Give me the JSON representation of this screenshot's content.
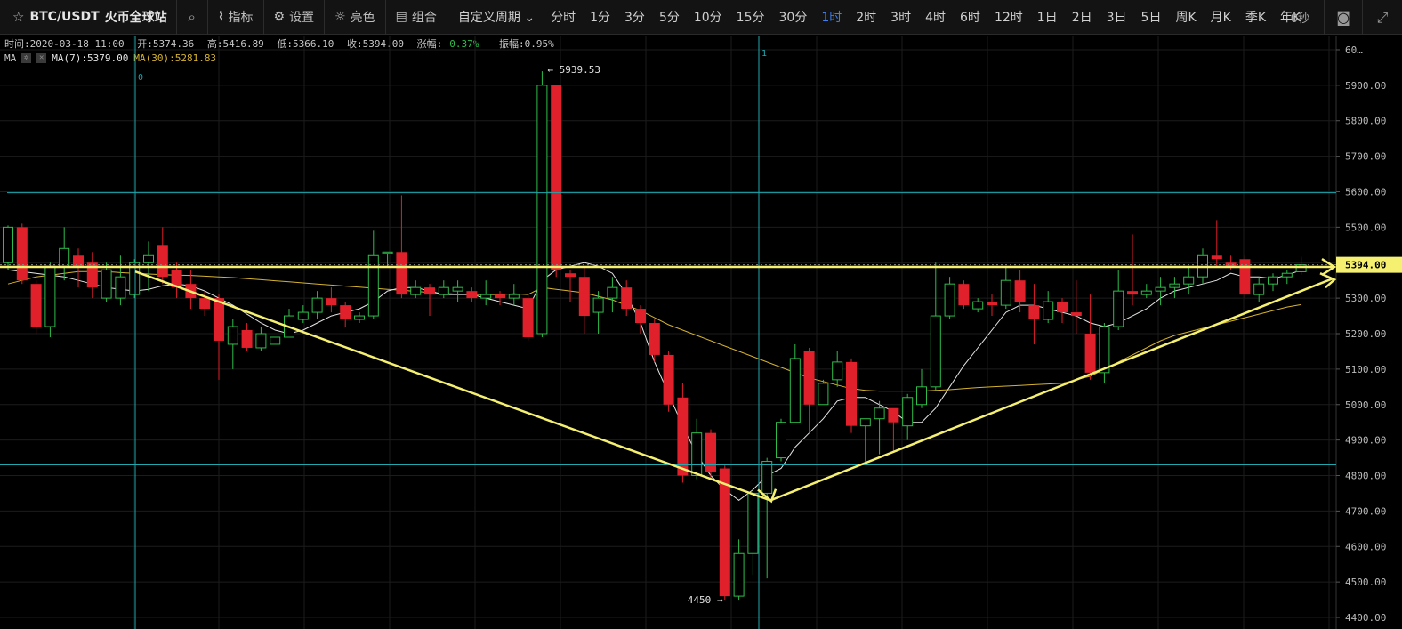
{
  "toolbar": {
    "symbol": "BTC/USDT",
    "exchange": "火币全球站",
    "tools": [
      {
        "icon": "chart-indicator-icon",
        "glyph": "⌇",
        "label": "指标"
      },
      {
        "icon": "gear-icon",
        "glyph": "⚙",
        "label": "设置"
      },
      {
        "icon": "sun-icon",
        "glyph": "☼",
        "label": "亮色"
      },
      {
        "icon": "layout-icon",
        "glyph": "▤",
        "label": "组合"
      }
    ],
    "custom_period": "自定义周期",
    "periods": [
      "分时",
      "1分",
      "3分",
      "5分",
      "10分",
      "15分",
      "30分",
      "1时",
      "2时",
      "3时",
      "4时",
      "6时",
      "12时",
      "1日",
      "2日",
      "3日",
      "5日",
      "周K",
      "月K",
      "季K",
      "年K"
    ],
    "active_period": "1时",
    "countdown": "0秒"
  },
  "info": {
    "time": "时间:2020-03-18 11:00",
    "open": "开:5374.36",
    "high": "高:5416.89",
    "low": "低:5366.10",
    "close": "收:5394.00",
    "change_label": "涨幅:",
    "change_value": "0.37%",
    "amplitude": "振幅:0.95%"
  },
  "ma": {
    "label": "MA",
    "ma7": "MA(7):5379.00",
    "ma30": "MA(30):5281.83"
  },
  "colors": {
    "up": "#2fbd4a",
    "down": "#e0202a",
    "ma7": "#e6e6e6",
    "ma30": "#d4b22e",
    "trendline": "#f5f070",
    "crosshair": "#1fa8b0",
    "grid": "#1c1c1c",
    "active": "#3d7ff5"
  },
  "chart_data": {
    "type": "candlestick",
    "pair": "BTC/USDT",
    "interval": "1h",
    "ylim": [
      4380,
      6020
    ],
    "y_ticks": [
      4400,
      4500,
      4600,
      4700,
      4800,
      4900,
      5000,
      5100,
      5200,
      5300,
      5400,
      5500,
      5600,
      5700,
      5800,
      5900,
      6000
    ],
    "y_tick_labels": [
      "4400.00",
      "4500.00",
      "4600.00",
      "4700.00",
      "4800.00",
      "4900.00",
      "5000.00",
      "5100.00",
      "5200.00",
      "5300.00",
      "",
      "5500.00",
      "5600.00",
      "5700.00",
      "5800.00",
      "5900.00",
      "60…"
    ],
    "last_price": "5394.00",
    "last_price_value": 5394,
    "max_marker": {
      "index": 38,
      "label": "5939.53",
      "value": 5939.53
    },
    "min_marker": {
      "index": 51,
      "label": "4450",
      "value": 4450
    },
    "candles": [
      [
        5400,
        5500,
        5380,
        5505
      ],
      [
        5500,
        5350,
        5340,
        5510
      ],
      [
        5340,
        5220,
        5200,
        5350
      ],
      [
        5220,
        5390,
        5190,
        5400
      ],
      [
        5390,
        5440,
        5350,
        5500
      ],
      [
        5420,
        5390,
        5330,
        5440
      ],
      [
        5400,
        5330,
        5300,
        5430
      ],
      [
        5300,
        5380,
        5290,
        5400
      ],
      [
        5300,
        5360,
        5280,
        5420
      ],
      [
        5310,
        5400,
        5300,
        5410
      ],
      [
        5400,
        5420,
        5320,
        5460
      ],
      [
        5450,
        5360,
        5340,
        5500
      ],
      [
        5380,
        5330,
        5300,
        5400
      ],
      [
        5340,
        5300,
        5270,
        5380
      ],
      [
        5300,
        5270,
        5250,
        5320
      ],
      [
        5300,
        5180,
        5070,
        5310
      ],
      [
        5170,
        5220,
        5100,
        5240
      ],
      [
        5210,
        5160,
        5150,
        5230
      ],
      [
        5160,
        5200,
        5150,
        5220
      ],
      [
        5170,
        5190,
        5170,
        5190
      ],
      [
        5190,
        5250,
        5190,
        5270
      ],
      [
        5240,
        5260,
        5230,
        5280
      ],
      [
        5260,
        5300,
        5240,
        5320
      ],
      [
        5300,
        5280,
        5260,
        5330
      ],
      [
        5280,
        5240,
        5220,
        5290
      ],
      [
        5240,
        5250,
        5230,
        5260
      ],
      [
        5250,
        5420,
        5240,
        5490
      ],
      [
        5430,
        5430,
        5390,
        5430
      ],
      [
        5430,
        5310,
        5300,
        5590
      ],
      [
        5310,
        5330,
        5300,
        5350
      ],
      [
        5330,
        5310,
        5250,
        5340
      ],
      [
        5310,
        5330,
        5300,
        5350
      ],
      [
        5320,
        5330,
        5290,
        5350
      ],
      [
        5320,
        5300,
        5290,
        5330
      ],
      [
        5300,
        5310,
        5280,
        5350
      ],
      [
        5310,
        5300,
        5280,
        5320
      ],
      [
        5300,
        5310,
        5280,
        5340
      ],
      [
        5300,
        5190,
        5180,
        5310
      ],
      [
        5200,
        5900,
        5190,
        5939.53
      ],
      [
        5900,
        5380,
        5360,
        5900
      ],
      [
        5370,
        5360,
        5290,
        5380
      ],
      [
        5360,
        5250,
        5200,
        5390
      ],
      [
        5260,
        5300,
        5200,
        5320
      ],
      [
        5300,
        5330,
        5260,
        5360
      ],
      [
        5330,
        5270,
        5250,
        5350
      ],
      [
        5270,
        5230,
        5200,
        5280
      ],
      [
        5230,
        5140,
        5120,
        5240
      ],
      [
        5140,
        5000,
        4980,
        5150
      ],
      [
        5020,
        4800,
        4780,
        5060
      ],
      [
        4800,
        4920,
        4790,
        4960
      ],
      [
        4920,
        4810,
        4790,
        4930
      ],
      [
        4820,
        4460,
        4450,
        4830
      ],
      [
        4460,
        4580,
        4450,
        4620
      ],
      [
        4580,
        4750,
        4520,
        4760
      ],
      [
        4750,
        4840,
        4510,
        4850
      ],
      [
        4850,
        4950,
        4840,
        4960
      ],
      [
        4950,
        5130,
        4950,
        5170
      ],
      [
        5150,
        5000,
        4920,
        5160
      ],
      [
        5000,
        5060,
        5000,
        5070
      ],
      [
        5070,
        5120,
        5050,
        5150
      ],
      [
        5120,
        4940,
        4920,
        5130
      ],
      [
        4940,
        4960,
        4830,
        4960
      ],
      [
        4960,
        4990,
        4860,
        5010
      ],
      [
        4990,
        4950,
        4870,
        4980
      ],
      [
        4940,
        5020,
        4900,
        5030
      ],
      [
        5000,
        5050,
        4990,
        5100
      ],
      [
        5050,
        5250,
        5040,
        5400
      ],
      [
        5250,
        5340,
        5240,
        5360
      ],
      [
        5340,
        5280,
        5270,
        5350
      ],
      [
        5270,
        5290,
        5260,
        5300
      ],
      [
        5290,
        5280,
        5250,
        5310
      ],
      [
        5280,
        5350,
        5270,
        5390
      ],
      [
        5350,
        5290,
        5260,
        5380
      ],
      [
        5280,
        5240,
        5170,
        5340
      ],
      [
        5240,
        5290,
        5230,
        5320
      ],
      [
        5290,
        5260,
        5230,
        5300
      ],
      [
        5260,
        5250,
        5200,
        5350
      ],
      [
        5200,
        5090,
        5070,
        5310
      ],
      [
        5090,
        5220,
        5060,
        5230
      ],
      [
        5220,
        5320,
        5210,
        5380
      ],
      [
        5320,
        5310,
        5280,
        5480
      ],
      [
        5310,
        5320,
        5300,
        5340
      ],
      [
        5320,
        5330,
        5280,
        5360
      ],
      [
        5330,
        5340,
        5300,
        5360
      ],
      [
        5340,
        5360,
        5310,
        5390
      ],
      [
        5360,
        5420,
        5340,
        5440
      ],
      [
        5420,
        5410,
        5390,
        5520
      ],
      [
        5400,
        5390,
        5380,
        5420
      ],
      [
        5410,
        5310,
        5300,
        5420
      ],
      [
        5310,
        5340,
        5290,
        5360
      ],
      [
        5340,
        5360,
        5320,
        5370
      ],
      [
        5360,
        5370,
        5340,
        5380
      ],
      [
        5374.36,
        5394.0,
        5366.1,
        5416.89
      ]
    ],
    "ma7": [
      5380,
      5375,
      5370,
      5365,
      5360,
      5350,
      5340,
      5330,
      5325,
      5320,
      5325,
      5335,
      5340,
      5335,
      5320,
      5300,
      5280,
      5255,
      5230,
      5210,
      5200,
      5210,
      5230,
      5250,
      5260,
      5270,
      5290,
      5320,
      5330,
      5330,
      5320,
      5310,
      5310,
      5310,
      5300,
      5290,
      5280,
      5270,
      5350,
      5380,
      5390,
      5400,
      5390,
      5370,
      5310,
      5230,
      5120,
      5030,
      4940,
      4860,
      4800,
      4760,
      4730,
      4760,
      4800,
      4820,
      4880,
      4920,
      4960,
      5010,
      5020,
      5020,
      5000,
      4980,
      4950,
      4950,
      4990,
      5050,
      5110,
      5160,
      5210,
      5260,
      5280,
      5280,
      5270,
      5260,
      5250,
      5230,
      5220,
      5230,
      5250,
      5270,
      5300,
      5320,
      5330,
      5340,
      5350,
      5370,
      5360,
      5360,
      5355,
      5365,
      5379
    ],
    "ma30": [
      5340,
      5350,
      5360,
      5365,
      5370,
      5375,
      5375,
      5375,
      5372,
      5370,
      5368,
      5366,
      5365,
      5364,
      5362,
      5360,
      5358,
      5355,
      5352,
      5349,
      5346,
      5343,
      5340,
      5337,
      5334,
      5331,
      5328,
      5325,
      5322,
      5319,
      5316,
      5313,
      5311,
      5310,
      5310,
      5310,
      5312,
      5310,
      5330,
      5325,
      5320,
      5315,
      5305,
      5295,
      5280,
      5265,
      5245,
      5225,
      5210,
      5195,
      5180,
      5165,
      5150,
      5135,
      5120,
      5105,
      5090,
      5075,
      5065,
      5055,
      5045,
      5040,
      5038,
      5038,
      5038,
      5038,
      5040,
      5042,
      5045,
      5048,
      5050,
      5052,
      5054,
      5056,
      5058,
      5060,
      5070,
      5080,
      5100,
      5120,
      5140,
      5160,
      5180,
      5195,
      5205,
      5215,
      5225,
      5235,
      5245,
      5255,
      5265,
      5275,
      5281.83
    ]
  }
}
